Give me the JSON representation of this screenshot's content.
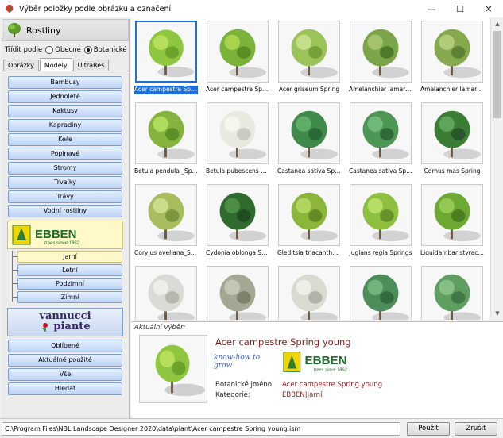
{
  "window": {
    "title": "Výběr položky podle obrázku a označení",
    "controls": [
      "minimize-icon",
      "maximize-icon",
      "close-icon"
    ]
  },
  "sidebar": {
    "category_title": "Rostliny",
    "sort_label": "Třídit podle",
    "sort_options": [
      {
        "label": "Obecné",
        "selected": false
      },
      {
        "label": "Botanické",
        "selected": true
      }
    ],
    "tabs": [
      {
        "label": "Obrázky",
        "active": false
      },
      {
        "label": "Modely",
        "active": true
      },
      {
        "label": "UltraRes",
        "active": false
      }
    ],
    "categories": [
      "Bambusy",
      "Jednoleté",
      "Kaktusy",
      "Kapradiny",
      "Keře",
      "Popínavé",
      "Stromy",
      "Trvalky",
      "Trávy",
      "Vodní rostliny"
    ],
    "brand1": {
      "name": "EBBEN",
      "tagline": "trees since 1862"
    },
    "subcategories": [
      {
        "label": "Jarní",
        "selected": true
      },
      {
        "label": "Letní",
        "selected": false
      },
      {
        "label": "Podzimní",
        "selected": false
      },
      {
        "label": "Zimní",
        "selected": false
      }
    ],
    "brand2": {
      "line1": "vannucci",
      "line2": "piante"
    },
    "bottom": [
      "Oblíbené",
      "Aktuálně použité",
      "Vše",
      "Hledat"
    ]
  },
  "grid": {
    "items": [
      {
        "caption": "Acer campestre Spring young",
        "selected": true
      },
      {
        "caption": "Acer campestre Spring",
        "selected": false
      },
      {
        "caption": "Acer griseum Spring",
        "selected": false
      },
      {
        "caption": "Amelanchier lamarkii ...",
        "selected": false
      },
      {
        "caption": "Amelanchier lamarkii ...",
        "selected": false
      },
      {
        "caption": "Betula pendula _Spring",
        "selected": false
      },
      {
        "caption": "Betula pubescens _S...",
        "selected": false
      },
      {
        "caption": "Castanea sativa Spring",
        "selected": false
      },
      {
        "caption": "Castanea sativa Spring",
        "selected": false
      },
      {
        "caption": "Cornus mas Spring",
        "selected": false
      },
      {
        "caption": "Corylus avellana_Spri...",
        "selected": false
      },
      {
        "caption": "Cydonia oblonga SP...",
        "selected": false
      },
      {
        "caption": "Gleditsia triacanthos ...",
        "selected": false
      },
      {
        "caption": "Juglans regia Springs",
        "selected": false
      },
      {
        "caption": "Liquidambar styraciflu...",
        "selected": false
      },
      {
        "caption": "",
        "selected": false
      },
      {
        "caption": "",
        "selected": false
      },
      {
        "caption": "",
        "selected": false
      },
      {
        "caption": "",
        "selected": false
      },
      {
        "caption": "",
        "selected": false
      }
    ]
  },
  "info": {
    "label": "Aktuální výběr:",
    "name": "Acer campestre Spring young",
    "brand_slogan": "know-how to grow",
    "brand_name": "EBBEN",
    "brand_tagline": "trees since 1862",
    "botanical_label": "Botanické jméno:",
    "botanical_value": "Acer campestre Spring young",
    "category_label": "Kategorie:",
    "category_value": "EBBEN|Jarní"
  },
  "status": {
    "path": "C:\\Program Files\\NBL Landscape Designer 2020\\data\\plant\\Acer campestre Spring young.ism",
    "apply_label": "Použít",
    "cancel_label": "Zrušit"
  },
  "colors": {
    "accent": "#1e6fd9",
    "highlight_name": "#8b1a1a",
    "button_blue": "#bcd3f5",
    "selected_yellow": "#fff8c8"
  }
}
